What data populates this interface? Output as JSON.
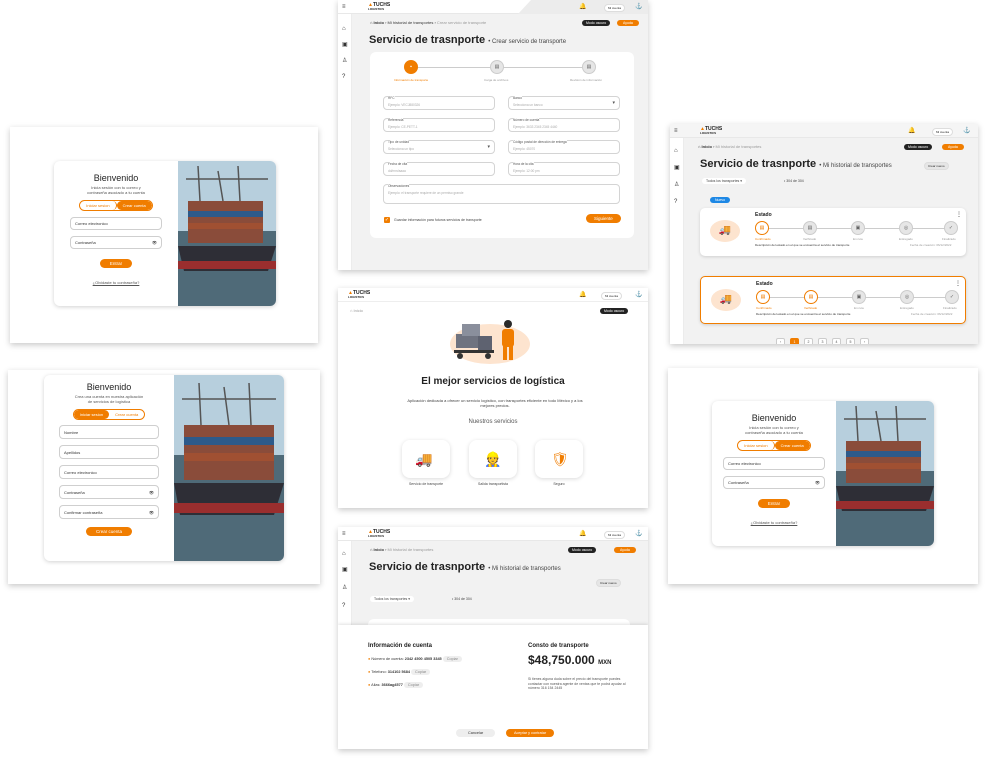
{
  "brand": {
    "name": "TUCHS",
    "sub": "LOGISTICS",
    "accent": "#f07d00"
  },
  "login": {
    "title": "Bienvenido",
    "subtitle": "Inicia sesión con tu correo y contraseña asociado a tu cuenta",
    "tab_login": "Iniciar sesion",
    "tab_register": "Crear cuenta",
    "email": "Correo electronico",
    "password": "Contraseña",
    "submit": "Entrar",
    "forgot": "¿Olvidaste tu contraseña?"
  },
  "register": {
    "title": "Bienvenido",
    "subtitle": "Crea una cuenta en nuestra aplicación de servicios de logística",
    "tab_login": "Iniciar sesion",
    "tab_register": "Crear cuenta",
    "fields": [
      "Nombre",
      "Apellidos",
      "Correo electronico",
      "Contraseña",
      "Confirmar contraseña"
    ],
    "submit": "Crear cuenta"
  },
  "shell": {
    "crumb_home": "Inicio",
    "crumb_history": "Mi historial de transportes",
    "crumb_create": "Crear servicio de transporte",
    "dark_mode": "Modo oscuro",
    "help": "Ayuda",
    "user": "Mi cuenta"
  },
  "create": {
    "title": "Servicio de trasnporte",
    "subtitle": "Crear servicio de transporte",
    "steps": [
      "Información de transporte",
      "Carga de archivos",
      "Revisión de información"
    ],
    "fields": [
      {
        "label": "RFC",
        "placeholder": "Ejemplo: VECJ880326"
      },
      {
        "label": "Banco",
        "placeholder": "Selecciona un banco"
      },
      {
        "label": "Referencia",
        "placeholder": "Ejemplo: CE-PETT-1"
      },
      {
        "label": "Número de cuenta",
        "placeholder": "Ejemplo: 3633 2345 2345 4440"
      },
      {
        "label": "Tipo de unidad",
        "placeholder": "Selecciona un tipo"
      },
      {
        "label": "Código postal de dirección de entrega",
        "placeholder": "Ejemplo: 45070"
      },
      {
        "label": "Fecha de cita",
        "placeholder": "dd/mm/aaaa"
      },
      {
        "label": "Hora de la cita",
        "placeholder": "Ejemplo: 12:00 pm"
      }
    ],
    "notes_label": "Observaciones",
    "notes_placeholder": "Ejemplo: el transporte requiere de un permiso grande",
    "save_label": "Guardar información para futuros servicios de transporte",
    "next": "Siguiente"
  },
  "history": {
    "title": "Servicio de trasnporte",
    "subtitle": "Mi historial de transportes",
    "create_new": "Crear nuevo",
    "filter": "Todos los transportes",
    "count": "304 de 304",
    "badge": "Nuevo",
    "status_label": "Estado",
    "steps": [
      "Confirmado",
      "Verificado",
      "En ruta",
      "Entregado",
      "Finalizado"
    ],
    "desc": "Descripción del estado en el que se encuentra el servicio de transporte",
    "date_label": "Fecha de creación: 06/12/2022",
    "pages": [
      "‹",
      "1",
      "2",
      "3",
      "4",
      "5",
      "›"
    ]
  },
  "home": {
    "title": "El mejor servicios de logística",
    "desc": "Aplicación dedicada a ofrecer un servicio logístico, con transportes eficiente en todo México y a los mejores precios.",
    "services_title": "Nuestros servicios",
    "services": [
      "Servicio de transporte",
      "Salida transportista",
      "Seguro"
    ]
  },
  "account": {
    "title": "Información de cuenta",
    "rows": [
      {
        "label": "Número de cuenta:",
        "value": "2342 4500 4505 3345",
        "action": "Copiar"
      },
      {
        "label": "Telefono:",
        "value": "314102 5684",
        "action": "Copiar"
      },
      {
        "label": "Alias:",
        "value": "3666ag4577",
        "action": "Copiar"
      }
    ],
    "cost_label": "Consto de transporte",
    "cost_value": "$48,750.000",
    "currency": "MXN",
    "note": "Si tienes alguna duda sobre el precio del transporte puedes contactar con nuestra agente de ventas que te podrá ayudar al número 316 154 2445",
    "cancel": "Cancelar",
    "confirm": "Aceptar y contratar"
  }
}
